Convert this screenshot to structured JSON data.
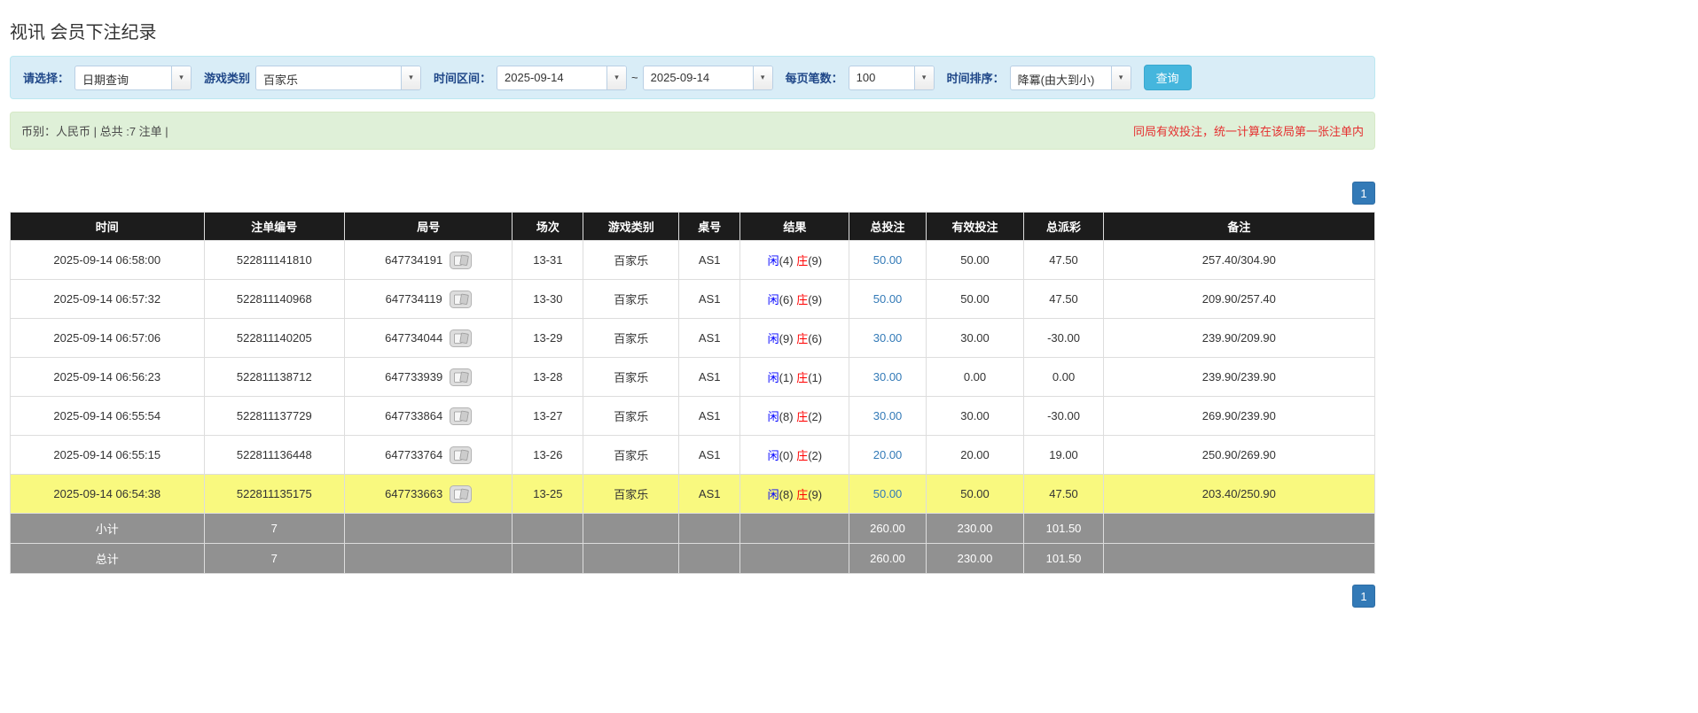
{
  "colors": {
    "accent_blue": "#337ab7",
    "label_blue": "#1f4788",
    "player_blue": "#0000ff",
    "banker_red": "#ff0000",
    "negative_red": "#e60000",
    "notice_red": "#e53030",
    "highlight_yellow": "#f9f97f",
    "header_bg": "#1c1c1c",
    "footer_bg": "#919191",
    "filter_bg": "#d9edf7",
    "filter_border": "#bce8f1",
    "summary_bg": "#dff0d8",
    "summary_border": "#d6e9c6",
    "query_btn": "#45b6dd"
  },
  "page": {
    "title": "视讯 会员下注纪录"
  },
  "filters": {
    "select_label": "请选择：",
    "select_value": "日期查询",
    "game_label": "游戏类别",
    "game_value": "百家乐",
    "range_label": "时间区间：",
    "date_from": "2025-09-14",
    "range_separator": "~",
    "date_to": "2025-09-14",
    "page_size_label": "每页笔数：",
    "page_size_value": "100",
    "sort_label": "时间排序：",
    "sort_value": "降冪(由大到小)",
    "query_button": "查询"
  },
  "summary": {
    "left": "币别：人民币 | 总共 :7 注单 |",
    "notice": "同局有效投注，统一计算在该局第一张注单内"
  },
  "pagination": {
    "page": "1"
  },
  "table": {
    "headers": [
      "时间",
      "注单编号",
      "局号",
      "场次",
      "游戏类别",
      "桌号",
      "结果",
      "总投注",
      "有效投注",
      "总派彩",
      "备注"
    ],
    "rows": [
      {
        "time": "2025-09-14 06:58:00",
        "bet_id": "522811141810",
        "round_id": "647734191",
        "session": "13-31",
        "game": "百家乐",
        "table_no": "AS1",
        "player_label": "闲",
        "player_score": "(4)",
        "banker_label": "庄",
        "banker_score": "(9)",
        "total_bet": "50.00",
        "valid_bet": "50.00",
        "payout": "47.50",
        "remark": "257.40/304.90",
        "highlighted": false
      },
      {
        "time": "2025-09-14 06:57:32",
        "bet_id": "522811140968",
        "round_id": "647734119",
        "session": "13-30",
        "game": "百家乐",
        "table_no": "AS1",
        "player_label": "闲",
        "player_score": "(6)",
        "banker_label": "庄",
        "banker_score": "(9)",
        "total_bet": "50.00",
        "valid_bet": "50.00",
        "payout": "47.50",
        "remark": "209.90/257.40",
        "highlighted": false
      },
      {
        "time": "2025-09-14 06:57:06",
        "bet_id": "522811140205",
        "round_id": "647734044",
        "session": "13-29",
        "game": "百家乐",
        "table_no": "AS1",
        "player_label": "闲",
        "player_score": "(9)",
        "banker_label": "庄",
        "banker_score": "(6)",
        "total_bet": "30.00",
        "valid_bet": "30.00",
        "payout": "-30.00",
        "remark": "239.90/209.90",
        "highlighted": false
      },
      {
        "time": "2025-09-14 06:56:23",
        "bet_id": "522811138712",
        "round_id": "647733939",
        "session": "13-28",
        "game": "百家乐",
        "table_no": "AS1",
        "player_label": "闲",
        "player_score": "(1)",
        "banker_label": "庄",
        "banker_score": "(1)",
        "total_bet": "30.00",
        "valid_bet": "0.00",
        "payout": "0.00",
        "remark": "239.90/239.90",
        "highlighted": false
      },
      {
        "time": "2025-09-14 06:55:54",
        "bet_id": "522811137729",
        "round_id": "647733864",
        "session": "13-27",
        "game": "百家乐",
        "table_no": "AS1",
        "player_label": "闲",
        "player_score": "(8)",
        "banker_label": "庄",
        "banker_score": "(2)",
        "total_bet": "30.00",
        "valid_bet": "30.00",
        "payout": "-30.00",
        "remark": "269.90/239.90",
        "highlighted": false
      },
      {
        "time": "2025-09-14 06:55:15",
        "bet_id": "522811136448",
        "round_id": "647733764",
        "session": "13-26",
        "game": "百家乐",
        "table_no": "AS1",
        "player_label": "闲",
        "player_score": "(0)",
        "banker_label": "庄",
        "banker_score": "(2)",
        "total_bet": "20.00",
        "valid_bet": "20.00",
        "payout": "19.00",
        "remark": "250.90/269.90",
        "highlighted": false
      },
      {
        "time": "2025-09-14 06:54:38",
        "bet_id": "522811135175",
        "round_id": "647733663",
        "session": "13-25",
        "game": "百家乐",
        "table_no": "AS1",
        "player_label": "闲",
        "player_score": "(8)",
        "banker_label": "庄",
        "banker_score": "(9)",
        "total_bet": "50.00",
        "valid_bet": "50.00",
        "payout": "47.50",
        "remark": "203.40/250.90",
        "highlighted": true
      }
    ],
    "subtotal": {
      "label": "小计",
      "count": "7",
      "total_bet": "260.00",
      "valid_bet": "230.00",
      "payout": "101.50"
    },
    "total": {
      "label": "总计",
      "count": "7",
      "total_bet": "260.00",
      "valid_bet": "230.00",
      "payout": "101.50"
    }
  }
}
